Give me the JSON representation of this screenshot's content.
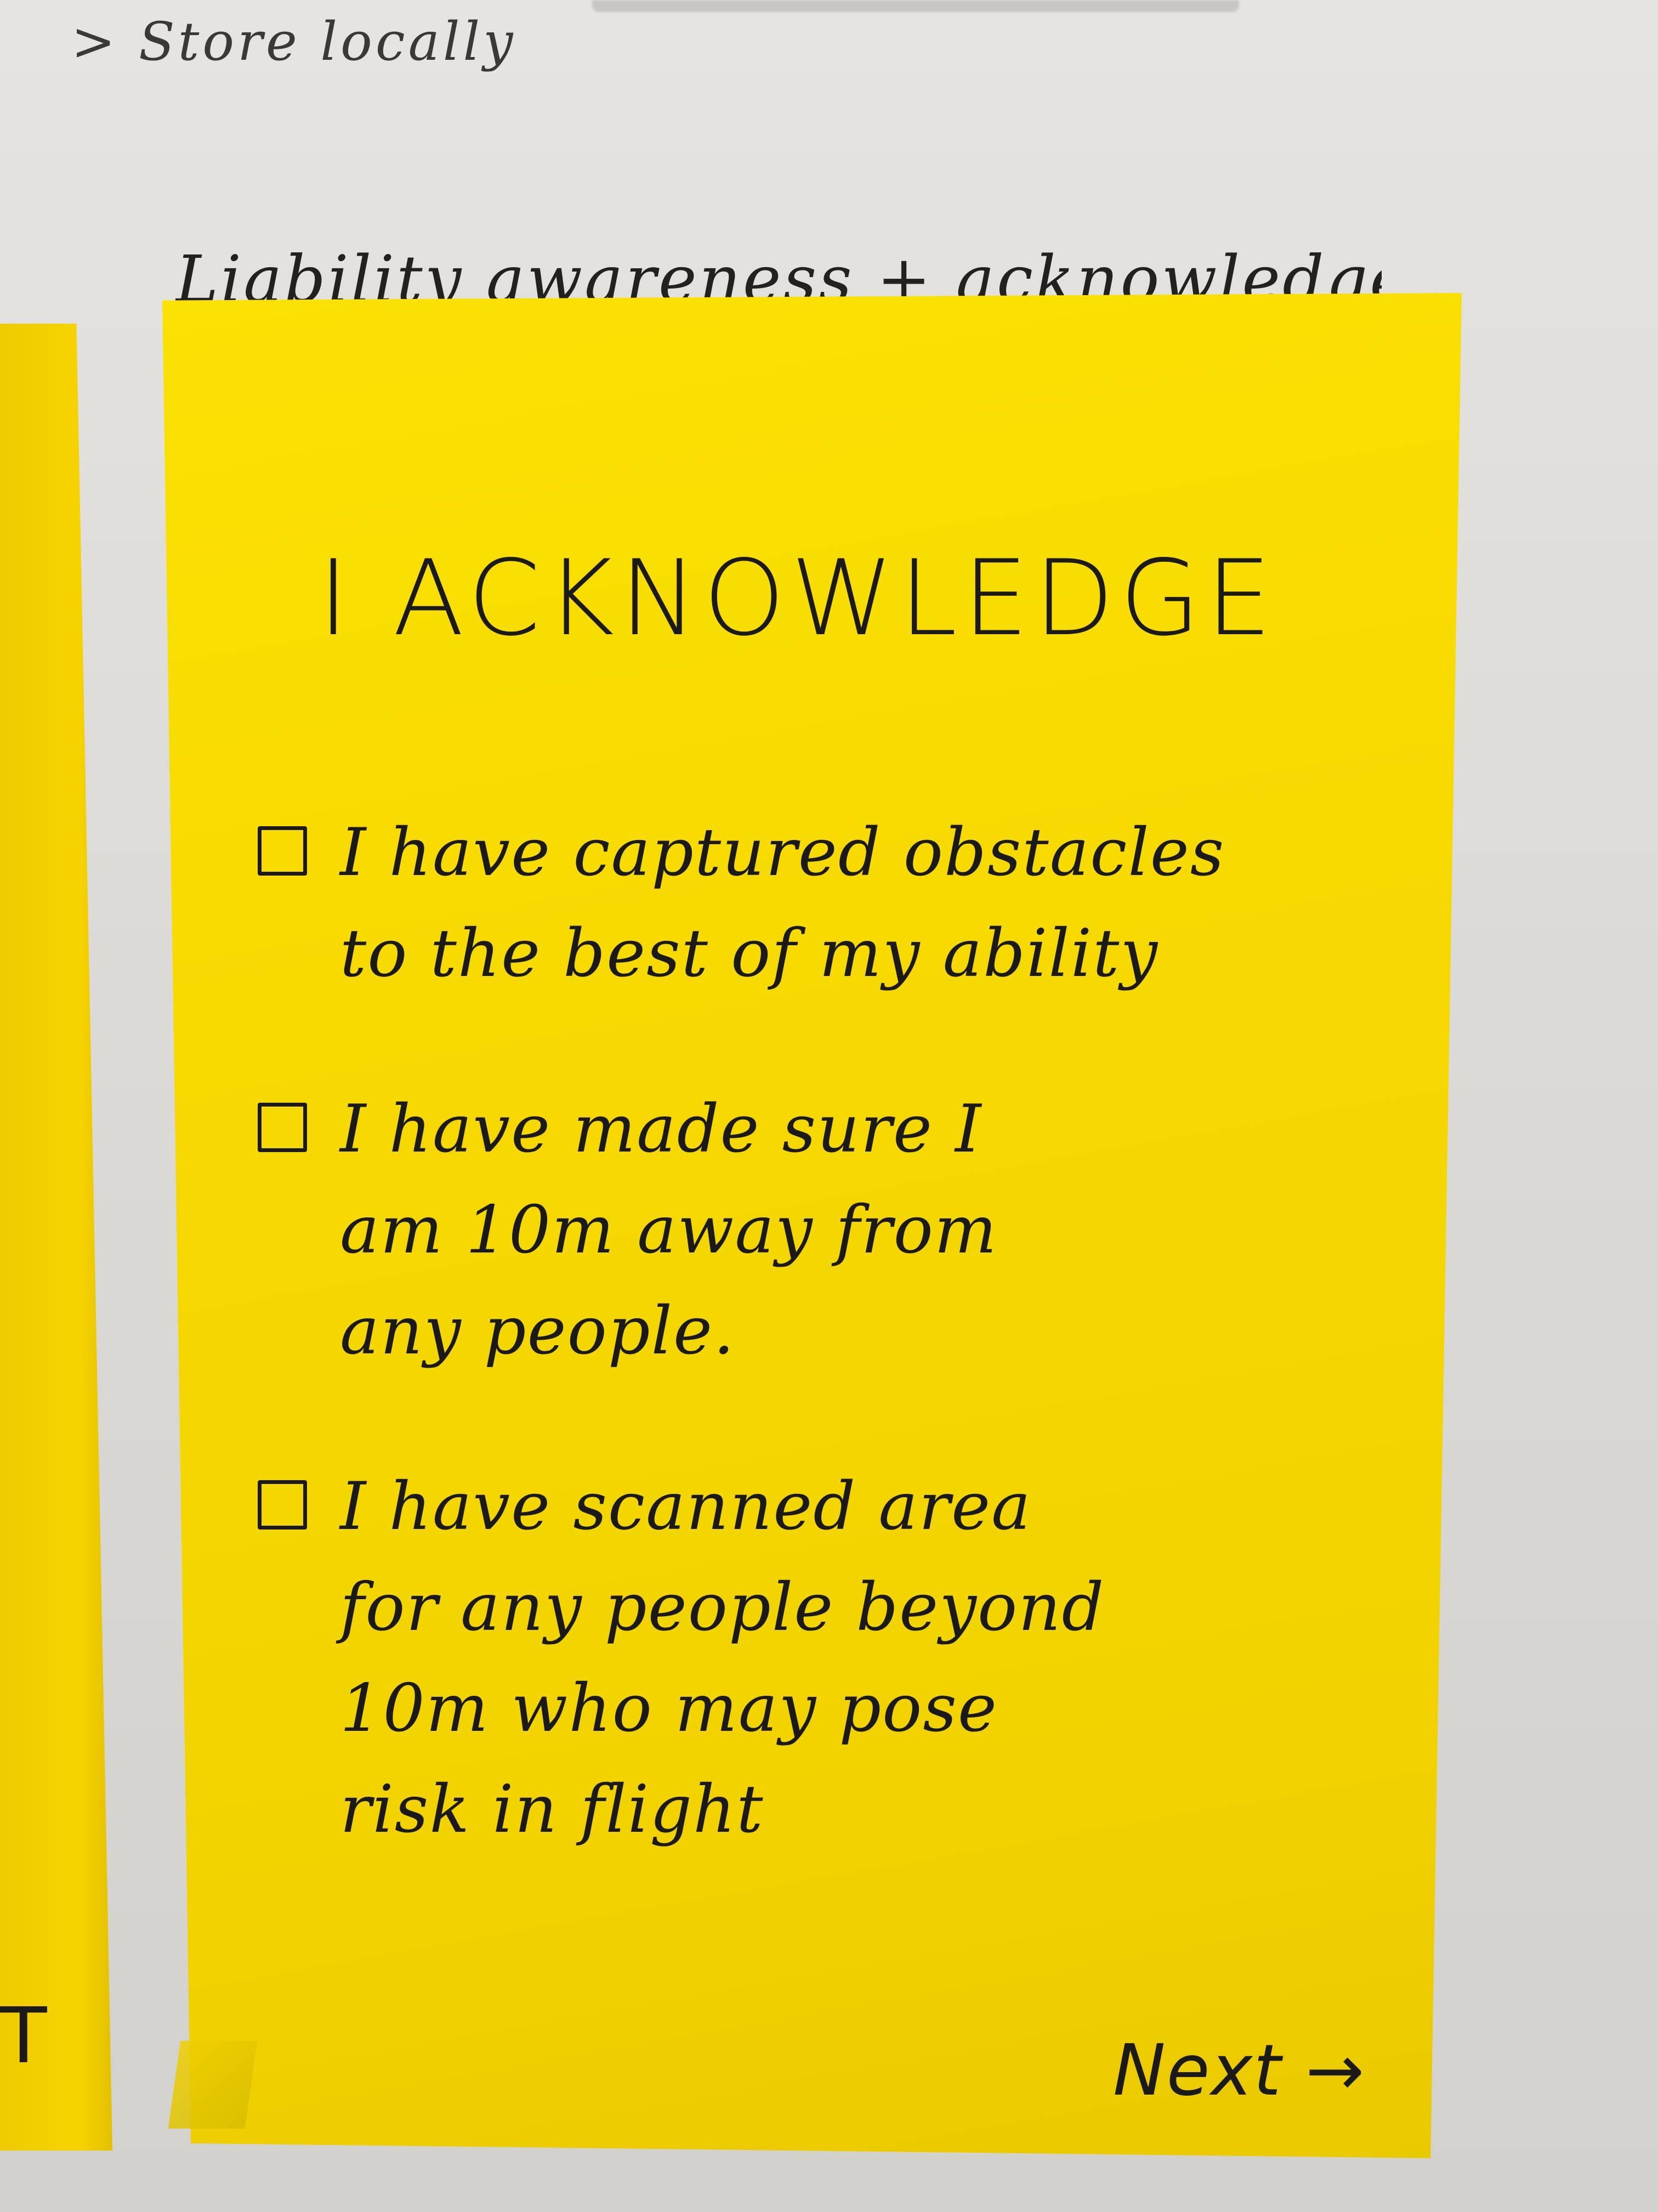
{
  "wall": {
    "note_top": "> Store locally",
    "note_heading": "Liability awareness + acknowledge"
  },
  "left_sticky": {
    "mark": "T"
  },
  "sticky_note": {
    "title": "I ACKNOWLEDGE",
    "items": [
      {
        "checked": false,
        "lines": [
          "I have captured obstacles",
          "to the best of my ability"
        ]
      },
      {
        "checked": false,
        "lines": [
          "I have made sure I",
          "am 10m away from",
          "any people."
        ]
      },
      {
        "checked": false,
        "lines": [
          "I have scanned area",
          "for any people beyond",
          "10m who may pose",
          "risk in flight"
        ]
      }
    ],
    "next_label": "Next →"
  },
  "colors": {
    "sticky_yellow": "#f6d900",
    "ink": "#1b1a17",
    "wall": "#dcdad6"
  }
}
